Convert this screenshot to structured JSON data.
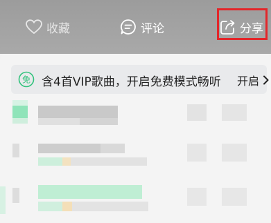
{
  "header": {
    "favorite_label": "收藏",
    "comment_label": "评论",
    "share_label": "分享",
    "favorite_icon": "heart-outline-icon",
    "comment_icon": "chat-bubble-icon",
    "share_icon": "share-arrow-icon"
  },
  "vip_banner": {
    "text": "含4首VIP歌曲，开启免费模式畅听",
    "action_label": "开启",
    "icon_text": "免",
    "icon": "free-mode-icon",
    "accent_color": "#31c27c"
  },
  "colors": {
    "header_bg": "#a4a4a4",
    "highlight_border": "#e3262a"
  }
}
